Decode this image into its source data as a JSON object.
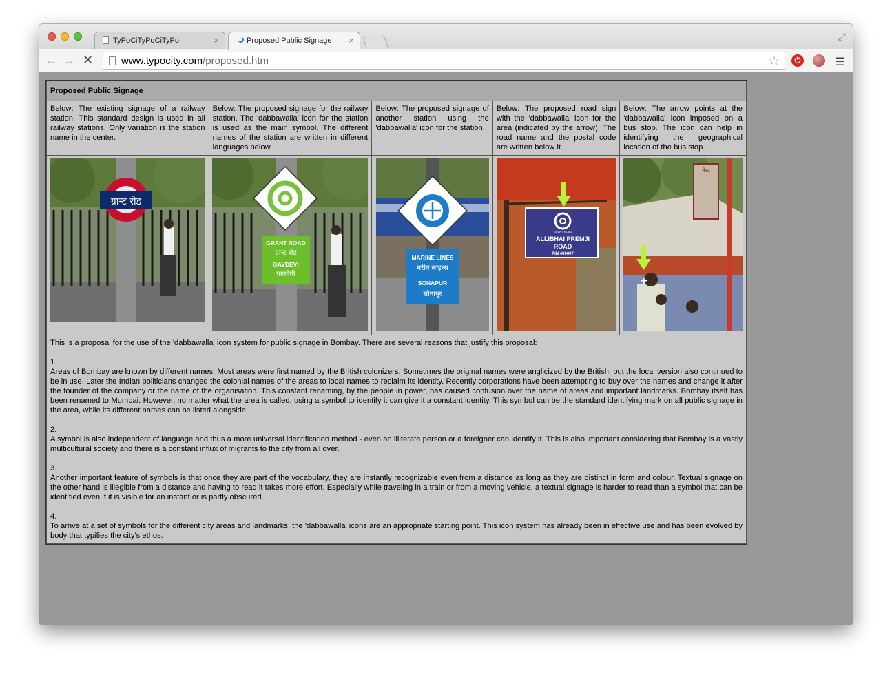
{
  "browser": {
    "tabs": [
      {
        "label": "TyPoCiTyPoCiTyPo",
        "close": "×"
      },
      {
        "label": "Proposed Public Signage",
        "close": "×"
      }
    ],
    "url_domain": "www.typocity.com",
    "url_path": "/proposed.htm",
    "icons": [
      "back-icon",
      "forward-icon",
      "stop-icon",
      "page-icon",
      "star-icon",
      "adblock-icon",
      "extension-icon",
      "menu-icon",
      "fullscreen-icon"
    ]
  },
  "page": {
    "title": "Proposed Public Signage",
    "captions": [
      "Below: The existing signage of a railway station. This standard design is used in all railway stations. Only variation is the station name in the center.",
      "Below: The proposed signage for the railway station. The 'dabbawalla' icon for the station is used as the main symbol. The different names of the station are written in different languages below.",
      "Below: The proposed signage of another station using the 'dabbawalla' icon for the station.",
      "Below: The proposed road sign with the 'dabbawalla' icon for the area (indicated by the arrow). The road name and the postal code are written below it.",
      "Below: The arrow points at the 'dabbawalla' icon imposed on a bus stop. The icon can help in identifying the geographical location of the bus stop."
    ],
    "photo1": {
      "sign_text": "ग्रान्ट रोड"
    },
    "photo2": {
      "sign_lines": [
        "GRANT ROAD",
        "ग्रान्ट रोड",
        "GAVDEVI",
        "गावदेवी"
      ]
    },
    "photo3": {
      "sign_lines": [
        "MARINE LINES",
        "मरीन लाइन्स",
        "SONAPUR",
        "सोनापूर"
      ]
    },
    "photo4": {
      "small": "GRANT ROAD",
      "line1": "ALLIBHAI PREMJI",
      "line2": "ROAD",
      "pin": "PIN 400007"
    },
    "photo5": {
      "board": "बेस्ट"
    },
    "intro": "This is a proposal for the use of the 'dabbawalla' icon system for public signage in Bombay. There are several reasons that justify this proposal:",
    "points": [
      {
        "num": "1.",
        "text": "Areas of Bombay are known by different names. Most areas were first named by the British colonizers. Sometimes the original names were anglicized by the British, but the local version also continued to be in use. Later the Indian politicians changed the colonial names of the areas to local names to reclaim its identity. Recently corporations have been attempting to buy over the names and change it after the founder of the company or the name of the organisation. This constant renaming, by the people in power, has caused confusion over the name of areas and important landmarks. Bombay itself has been renamed to Mumbai. However, no matter what the area is called, using a symbol to identify it can give it a constant identity. This symbol can be the standard identifying mark on all public signage in the area, while its different names can be listed alongside."
      },
      {
        "num": "2.",
        "text": "A symbol is also independent of language and thus a more universal identification method - even an illiterate person or a foreigner can identify it. This is also important considering that Bombay is a vastly multicultural society and there is a constant influx of migrants to the city from all over."
      },
      {
        "num": "3.",
        "text": "Another important feature of symbols is that once they are part of the vocabulary, they are instantly recognizable even from a distance as long as they are distinct in form and colour. Textual signage on the other hand is illegible from a distance and having to read it takes more effort. Especially while traveling in a train or from a moving vehicle, a textual signage is harder to read than a symbol that can be identified even if it is visible for an instant or is partly obscured."
      },
      {
        "num": "4.",
        "text": "To arrive at a set of symbols for the different city areas and landmarks, the 'dabbawalla' icons are an appropriate starting point. This icon system has already been in effective use and has been evolved by body that typifies the city's ethos."
      }
    ],
    "trailing": ".."
  }
}
